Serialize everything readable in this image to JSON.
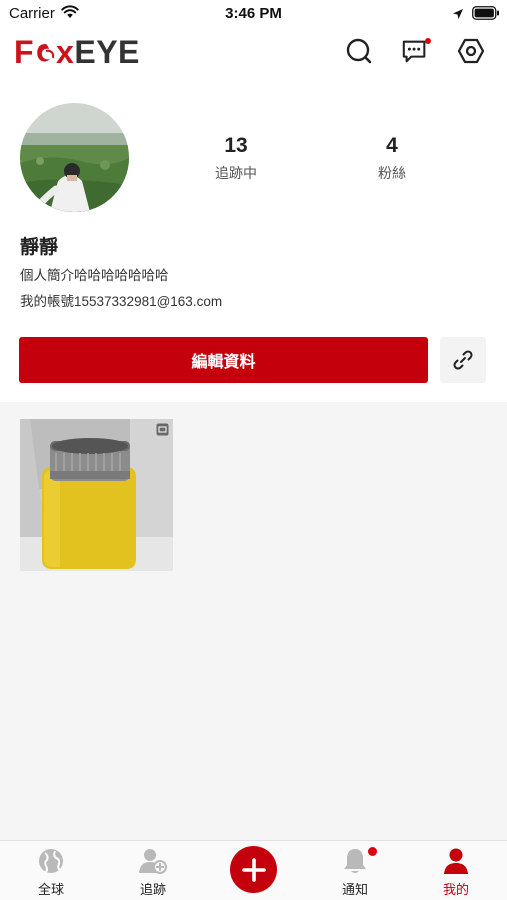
{
  "status_bar": {
    "carrier": "Carrier",
    "time": "3:46 PM"
  },
  "header": {
    "logo_f": "F",
    "logo_x": "x",
    "logo_eye": "EYE",
    "icons": [
      "search-icon",
      "message-icon",
      "settings-icon"
    ],
    "message_has_dot": true
  },
  "profile": {
    "name": "靜靜",
    "bio": "個人簡介哈哈哈哈哈哈哈",
    "account": "我的帳號15537332981@163.com",
    "stats": [
      {
        "value": "13",
        "label": "追跡中"
      },
      {
        "value": "4",
        "label": "粉絲"
      }
    ],
    "edit_button": "編輯資料"
  },
  "posts": [
    {
      "type": "image",
      "subject": "yellow-thermos"
    }
  ],
  "tabbar": {
    "items": [
      {
        "label": "全球",
        "icon": "globe-icon"
      },
      {
        "label": "追跡",
        "icon": "follow-icon"
      },
      {
        "label": "通知",
        "icon": "bell-icon",
        "dot": true
      },
      {
        "label": "我的",
        "icon": "person-icon",
        "active": true
      }
    ]
  },
  "colors": {
    "brand": "#c4000d",
    "background_posts": "#f5f5f5"
  }
}
